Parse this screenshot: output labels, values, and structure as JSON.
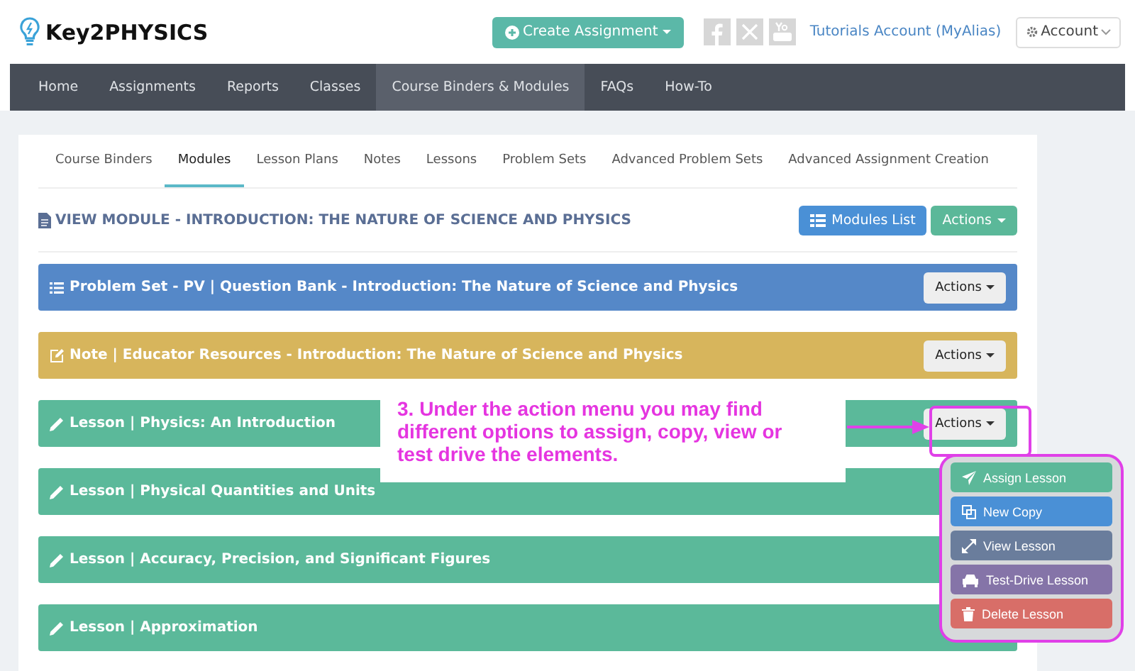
{
  "logo": {
    "text": "Key2PHYSICS"
  },
  "header": {
    "create_button": "Create Assignment",
    "account_link": "Tutorials Account (MyAlias)",
    "account_button": "Account"
  },
  "nav": [
    {
      "label": "Home",
      "selected": false
    },
    {
      "label": "Assignments",
      "selected": false
    },
    {
      "label": "Reports",
      "selected": false
    },
    {
      "label": "Classes",
      "selected": false
    },
    {
      "label": "Course Binders & Modules",
      "selected": true
    },
    {
      "label": "FAQs",
      "selected": false
    },
    {
      "label": "How-To",
      "selected": false
    }
  ],
  "tabs": [
    {
      "label": "Course Binders",
      "selected": false
    },
    {
      "label": "Modules",
      "selected": true
    },
    {
      "label": "Lesson Plans",
      "selected": false
    },
    {
      "label": "Notes",
      "selected": false
    },
    {
      "label": "Lessons",
      "selected": false
    },
    {
      "label": "Problem Sets",
      "selected": false
    },
    {
      "label": "Advanced Problem Sets",
      "selected": false
    },
    {
      "label": "Advanced Assignment Creation",
      "selected": false
    }
  ],
  "module": {
    "title": "VIEW MODULE - INTRODUCTION: THE NATURE OF SCIENCE AND PHYSICS",
    "list_button": "Modules List",
    "actions_button": "Actions"
  },
  "rows": [
    {
      "kind": "problem_set",
      "title": "Problem Set - PV | Question Bank - Introduction: The Nature of Science and Physics",
      "actions": "Actions"
    },
    {
      "kind": "note",
      "title": "Note | Educator Resources - Introduction: The Nature of Science and Physics",
      "actions": "Actions"
    },
    {
      "kind": "lesson",
      "title": "Lesson | Physics: An Introduction",
      "actions": "Actions"
    },
    {
      "kind": "lesson",
      "title": "Lesson | Physical Quantities and Units"
    },
    {
      "kind": "lesson",
      "title": "Lesson | Accuracy, Precision, and Significant Figures"
    },
    {
      "kind": "lesson",
      "title": "Lesson | Approximation"
    }
  ],
  "callout": {
    "text": "3. Under the action menu you may find different options to assign, copy, view or test drive the elements."
  },
  "menu": [
    {
      "kind": "assign",
      "label": "Assign Lesson",
      "color": "#5cb899"
    },
    {
      "kind": "copy",
      "label": "New Copy",
      "color": "#4a90d6"
    },
    {
      "kind": "view",
      "label": "View Lesson",
      "color": "#6a7d9c"
    },
    {
      "kind": "drive",
      "label": "Test-Drive Lesson",
      "color": "#8574a8"
    },
    {
      "kind": "delete",
      "label": "Delete Lesson",
      "color": "#d86e68"
    }
  ]
}
